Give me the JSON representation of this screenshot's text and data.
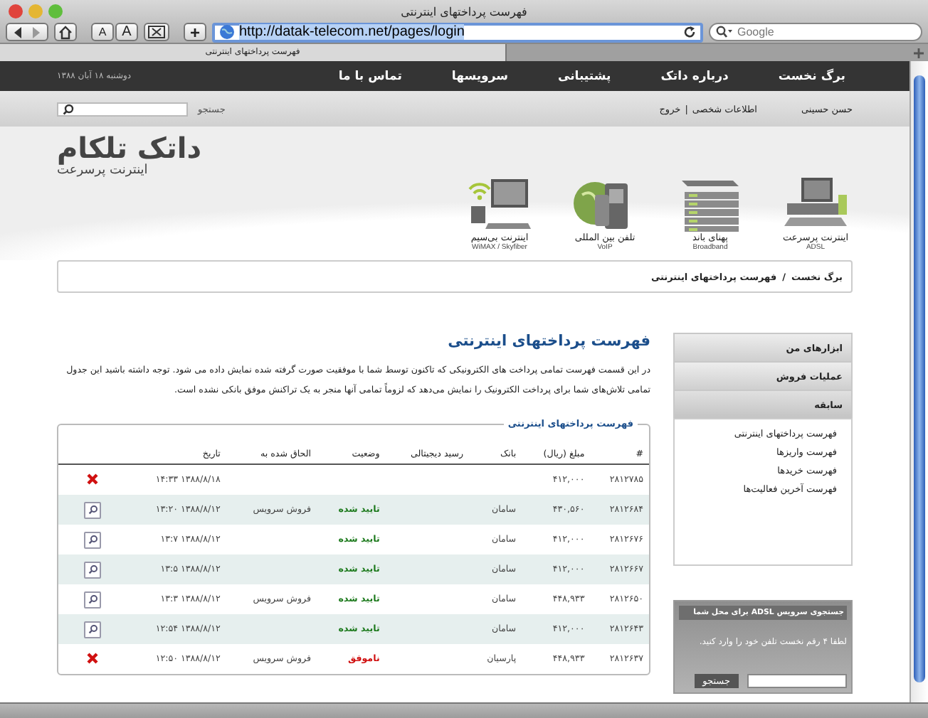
{
  "window": {
    "title": "فهرست پرداختهای اینترنتی"
  },
  "toolbar": {
    "url": "http://datak-telecom.net/pages/login",
    "search_placeholder": "Google",
    "font_smaller": "A",
    "font_larger": "A",
    "add": "+"
  },
  "tabs": [
    {
      "label": "فهرست پرداختهای اینترنتی",
      "selected": true
    }
  ],
  "nav": {
    "items": [
      "برگ نخست",
      "درباره داتک",
      "پشتیبانی",
      "سرویسها",
      "تماس با ما"
    ],
    "date": "دوشنبه ۱۸ آبان ۱۳۸۸"
  },
  "user_bar": {
    "name": "حسن حسینی",
    "links": [
      "اطلاعات شخصی",
      "خروج"
    ],
    "separator": "|",
    "search_label": "جستجو"
  },
  "logo": {
    "name": "داتک تلکام",
    "tagline": "اینترنت پرسرعت"
  },
  "services": [
    {
      "kind": "adsl",
      "label": "اینترنت پرسرعت",
      "sub": "ADSL"
    },
    {
      "kind": "broadband",
      "label": "پهنای باند",
      "sub": "Broadband"
    },
    {
      "kind": "voip",
      "label": "تلفن بین المللی",
      "sub": "VoIP"
    },
    {
      "kind": "wireless",
      "label": "اینترنت بی‌سیم",
      "sub": "WiMAX / Skyfiber"
    }
  ],
  "breadcrumb": [
    "برگ نخست",
    "فهرست پرداختهای اینترنتی"
  ],
  "breadcrumb_separator": "/",
  "page": {
    "title": "فهرست پرداختهای اینترنتی",
    "intro": "در این قسمت فهرست تمامی پرداخت های الکترونیکی که تاکنون توسط شما با موفقیت صورت گرفته شده نمایش داده می شود. توجه داشته باشید این جدول تمامی تلاش‌های شما برای پرداخت الکترونیک را نمایش می‌دهد که لزوماً تمامی آنها منجر به یک تراکنش موفق بانکی نشده است.",
    "legend": "فهرست پرداختهای اینترنتی"
  },
  "table": {
    "columns": [
      "#",
      "مبلغ (ریال)",
      "بانک",
      "رسید دیجیتالی",
      "وضعیت",
      "الحاق شده به",
      "تاریخ"
    ],
    "rows": [
      {
        "id": "۲۸۱۲۷۸۵",
        "amount": "۴۱۲,۰۰۰",
        "date": "۱۳۸۸/۸/۱۸ ۱۴:۳۳",
        "deletable": true
      },
      {
        "id": "۲۸۱۲۶۸۴",
        "amount": "۴۳۰,۵۶۰",
        "bank": "سامان",
        "status": "تایید شده",
        "approved": true,
        "attached": "فروش سرویس",
        "date": "۱۳۸۸/۸/۱۲ ۱۳:۲۰",
        "deletable": false
      },
      {
        "id": "۲۸۱۲۶۷۶",
        "amount": "۴۱۲,۰۰۰",
        "bank": "سامان",
        "status": "تایید شده",
        "approved": true,
        "date": "۱۳۸۸/۸/۱۲ ۱۳:۷",
        "deletable": false
      },
      {
        "id": "۲۸۱۲۶۶۷",
        "amount": "۴۱۲,۰۰۰",
        "bank": "سامان",
        "status": "تایید شده",
        "approved": true,
        "date": "۱۳۸۸/۸/۱۲ ۱۳:۵",
        "deletable": false
      },
      {
        "id": "۲۸۱۲۶۵۰",
        "amount": "۴۴۸,۹۳۳",
        "bank": "سامان",
        "status": "تایید شده",
        "approved": true,
        "attached": "فروش سرویس",
        "date": "۱۳۸۸/۸/۱۲ ۱۳:۳",
        "deletable": false
      },
      {
        "id": "۲۸۱۲۶۴۳",
        "amount": "۴۱۲,۰۰۰",
        "bank": "سامان",
        "status": "تایید شده",
        "approved": true,
        "date": "۱۳۸۸/۸/۱۲ ۱۲:۵۴",
        "deletable": false
      },
      {
        "id": "۲۸۱۲۶۳۷",
        "amount": "۴۴۸,۹۳۳",
        "bank": "پارسیان",
        "status": "ناموفق",
        "approved": false,
        "attached": "فروش سرویس",
        "date": "۱۳۸۸/۸/۱۲ ۱۲:۵۰",
        "deletable": true
      }
    ]
  },
  "sidebar": {
    "sections": [
      {
        "label": "ابزارهای من",
        "expanded": false
      },
      {
        "label": "عملیات فروش",
        "expanded": false
      },
      {
        "label": "سابقه",
        "expanded": true
      }
    ],
    "links": [
      "فهرست پرداختهای اینترنتی",
      "فهرست واریزها",
      "فهرست خریدها",
      "فهرست آخرین فعالیت‌ها"
    ]
  },
  "adsl_box": {
    "title": "جستجوی سرویس ADSL برای محل شما",
    "hint": "لطفا ۴ رقم نخست تلفن خود را وارد کنید.",
    "button": "جستجو"
  }
}
